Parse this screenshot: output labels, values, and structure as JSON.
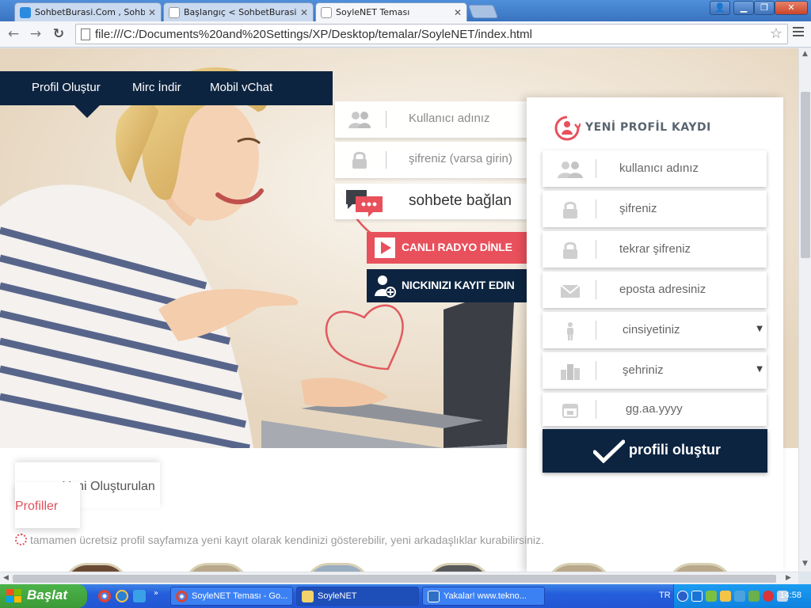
{
  "browser": {
    "tabs": [
      {
        "title": "SohbetBurasi.Com , Sohbet,",
        "close": "✕"
      },
      {
        "title": "Başlangıç < SohbetBurasi.Com",
        "close": "✕"
      },
      {
        "title": "SoyleNET Teması",
        "close": "✕"
      }
    ],
    "url": "file:///C:/Documents%20and%20Settings/XP/Desktop/temalar/SoyleNET/index.html"
  },
  "nav": {
    "items": [
      "Profil Oluştur",
      "Mirc İndir",
      "Mobil vChat"
    ]
  },
  "login": {
    "username_placeholder": "Kullanıcı adınız",
    "password_placeholder": "şifreniz (varsa girin)",
    "connect_label": "sohbete bağlan",
    "radio_label": "CANLI RADYO DİNLE",
    "register_label": "NICKINIZI KAYIT EDIN"
  },
  "register": {
    "title": "YENİ PROFİL KAYDI",
    "fields": {
      "username": "kullanıcı adınız",
      "password": "şifreniz",
      "password_repeat": "tekrar şifreniz",
      "email": "eposta adresiniz",
      "gender": "cinsiyetiniz",
      "city": "şehriniz",
      "birthdate": "gg.aa.yyyy"
    },
    "submit_label": "profili oluştur"
  },
  "profiles": {
    "tab_title": "Yeni Oluşturulan",
    "tab_title2": "Profiller",
    "description": "tamamen ücretsiz profil sayfamıza yeni kayıt olarak kendinizi gösterebilir, yeni arkadaşlıklar kurabilirsiniz."
  },
  "taskbar": {
    "start_label": "Başlat",
    "tasks": [
      "SoyleNET Teması - Go...",
      "SoyleNET",
      "Yakalar! www.tekno..."
    ],
    "language": "TR",
    "clock": "14:58"
  },
  "colors": {
    "navy": "#0d2440",
    "accent_red": "#e8505b"
  }
}
